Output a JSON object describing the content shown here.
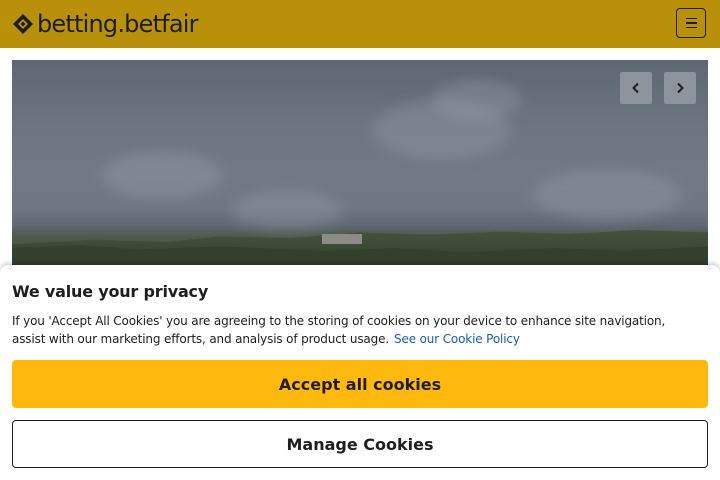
{
  "header": {
    "brand": "betting.betfair",
    "logo_icon": "betfair-logo-mark",
    "menu_icon": "hamburger-menu-icon",
    "background_color": "#b8900a"
  },
  "hero": {
    "prev_icon": "chevron-left-icon",
    "next_icon": "chevron-right-icon"
  },
  "cookie_banner": {
    "title": "We value your privacy",
    "body": "If you 'Accept All Cookies' you are agreeing to the storing of cookies on your device to enhance site navigation, assist with our marketing efforts, and analysis of product usage.",
    "policy_link": "See our Cookie Policy",
    "accept_label": "Accept all cookies",
    "manage_label": "Manage Cookies",
    "accept_color": "#ffb80c",
    "link_color": "#1a5fb4"
  }
}
